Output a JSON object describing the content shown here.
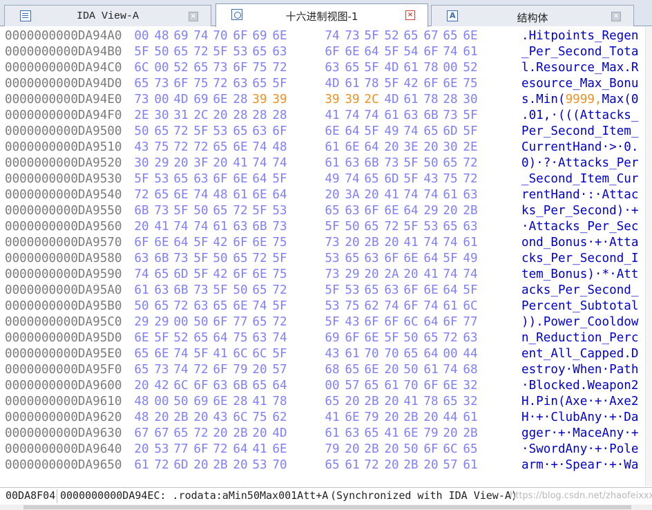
{
  "tabs": [
    {
      "label": "IDA View-A",
      "icon": "listing-icon",
      "active": false
    },
    {
      "label": "十六进制视图-1",
      "icon": "hex-view-icon",
      "active": true
    },
    {
      "label": "结构体",
      "icon": "structures-icon",
      "active": false
    }
  ],
  "close_glyph": "×",
  "hex_view": {
    "colors": {
      "address": "#7b7b7b",
      "bytes": "#8080ff",
      "highlight": "#f09020",
      "ascii": "#0000cc"
    },
    "rows": [
      {
        "address": "0000000000DA94A0",
        "bytes": [
          "00",
          "48",
          "69",
          "74",
          "70",
          "6F",
          "69",
          "6E",
          "74",
          "73",
          "5F",
          "52",
          "65",
          "67",
          "65",
          "6E"
        ],
        "ascii": ".Hitpoints_Regen"
      },
      {
        "address": "0000000000DA94B0",
        "bytes": [
          "5F",
          "50",
          "65",
          "72",
          "5F",
          "53",
          "65",
          "63",
          "6F",
          "6E",
          "64",
          "5F",
          "54",
          "6F",
          "74",
          "61"
        ],
        "ascii": "_Per_Second_Tota"
      },
      {
        "address": "0000000000DA94C0",
        "bytes": [
          "6C",
          "00",
          "52",
          "65",
          "73",
          "6F",
          "75",
          "72",
          "63",
          "65",
          "5F",
          "4D",
          "61",
          "78",
          "00",
          "52"
        ],
        "ascii": "l.Resource_Max.R"
      },
      {
        "address": "0000000000DA94D0",
        "bytes": [
          "65",
          "73",
          "6F",
          "75",
          "72",
          "63",
          "65",
          "5F",
          "4D",
          "61",
          "78",
          "5F",
          "42",
          "6F",
          "6E",
          "75"
        ],
        "ascii": "esource_Max_Bonu"
      },
      {
        "address": "0000000000DA94E0",
        "bytes": [
          "73",
          "00",
          "4D",
          "69",
          "6E",
          "28",
          "39",
          "39",
          "39",
          "39",
          "2C",
          "4D",
          "61",
          "78",
          "28",
          "30"
        ],
        "ascii": "s.Min(9999,Max(0",
        "highlight": [
          6,
          7,
          8,
          9,
          10
        ],
        "ascii_highlight": [
          6,
          11
        ]
      },
      {
        "address": "0000000000DA94F0",
        "bytes": [
          "2E",
          "30",
          "31",
          "2C",
          "20",
          "28",
          "28",
          "28",
          "41",
          "74",
          "74",
          "61",
          "63",
          "6B",
          "73",
          "5F"
        ],
        "ascii": ".01,·(((Attacks_"
      },
      {
        "address": "0000000000DA9500",
        "bytes": [
          "50",
          "65",
          "72",
          "5F",
          "53",
          "65",
          "63",
          "6F",
          "6E",
          "64",
          "5F",
          "49",
          "74",
          "65",
          "6D",
          "5F"
        ],
        "ascii": "Per_Second_Item_"
      },
      {
        "address": "0000000000DA9510",
        "bytes": [
          "43",
          "75",
          "72",
          "72",
          "65",
          "6E",
          "74",
          "48",
          "61",
          "6E",
          "64",
          "20",
          "3E",
          "20",
          "30",
          "2E"
        ],
        "ascii": "CurrentHand·>·0."
      },
      {
        "address": "0000000000DA9520",
        "bytes": [
          "30",
          "29",
          "20",
          "3F",
          "20",
          "41",
          "74",
          "74",
          "61",
          "63",
          "6B",
          "73",
          "5F",
          "50",
          "65",
          "72"
        ],
        "ascii": "0)·?·Attacks_Per"
      },
      {
        "address": "0000000000DA9530",
        "bytes": [
          "5F",
          "53",
          "65",
          "63",
          "6F",
          "6E",
          "64",
          "5F",
          "49",
          "74",
          "65",
          "6D",
          "5F",
          "43",
          "75",
          "72"
        ],
        "ascii": "_Second_Item_Cur"
      },
      {
        "address": "0000000000DA9540",
        "bytes": [
          "72",
          "65",
          "6E",
          "74",
          "48",
          "61",
          "6E",
          "64",
          "20",
          "3A",
          "20",
          "41",
          "74",
          "74",
          "61",
          "63"
        ],
        "ascii": "rentHand·:·Attac"
      },
      {
        "address": "0000000000DA9550",
        "bytes": [
          "6B",
          "73",
          "5F",
          "50",
          "65",
          "72",
          "5F",
          "53",
          "65",
          "63",
          "6F",
          "6E",
          "64",
          "29",
          "20",
          "2B"
        ],
        "ascii": "ks_Per_Second)·+"
      },
      {
        "address": "0000000000DA9560",
        "bytes": [
          "20",
          "41",
          "74",
          "74",
          "61",
          "63",
          "6B",
          "73",
          "5F",
          "50",
          "65",
          "72",
          "5F",
          "53",
          "65",
          "63"
        ],
        "ascii": "·Attacks_Per_Sec"
      },
      {
        "address": "0000000000DA9570",
        "bytes": [
          "6F",
          "6E",
          "64",
          "5F",
          "42",
          "6F",
          "6E",
          "75",
          "73",
          "20",
          "2B",
          "20",
          "41",
          "74",
          "74",
          "61"
        ],
        "ascii": "ond_Bonus·+·Atta"
      },
      {
        "address": "0000000000DA9580",
        "bytes": [
          "63",
          "6B",
          "73",
          "5F",
          "50",
          "65",
          "72",
          "5F",
          "53",
          "65",
          "63",
          "6F",
          "6E",
          "64",
          "5F",
          "49"
        ],
        "ascii": "cks_Per_Second_I"
      },
      {
        "address": "0000000000DA9590",
        "bytes": [
          "74",
          "65",
          "6D",
          "5F",
          "42",
          "6F",
          "6E",
          "75",
          "73",
          "29",
          "20",
          "2A",
          "20",
          "41",
          "74",
          "74"
        ],
        "ascii": "tem_Bonus)·*·Att"
      },
      {
        "address": "0000000000DA95A0",
        "bytes": [
          "61",
          "63",
          "6B",
          "73",
          "5F",
          "50",
          "65",
          "72",
          "5F",
          "53",
          "65",
          "63",
          "6F",
          "6E",
          "64",
          "5F"
        ],
        "ascii": "acks_Per_Second_"
      },
      {
        "address": "0000000000DA95B0",
        "bytes": [
          "50",
          "65",
          "72",
          "63",
          "65",
          "6E",
          "74",
          "5F",
          "53",
          "75",
          "62",
          "74",
          "6F",
          "74",
          "61",
          "6C"
        ],
        "ascii": "Percent_Subtotal"
      },
      {
        "address": "0000000000DA95C0",
        "bytes": [
          "29",
          "29",
          "00",
          "50",
          "6F",
          "77",
          "65",
          "72",
          "5F",
          "43",
          "6F",
          "6F",
          "6C",
          "64",
          "6F",
          "77"
        ],
        "ascii": ")).Power_Cooldow"
      },
      {
        "address": "0000000000DA95D0",
        "bytes": [
          "6E",
          "5F",
          "52",
          "65",
          "64",
          "75",
          "63",
          "74",
          "69",
          "6F",
          "6E",
          "5F",
          "50",
          "65",
          "72",
          "63"
        ],
        "ascii": "n_Reduction_Perc"
      },
      {
        "address": "0000000000DA95E0",
        "bytes": [
          "65",
          "6E",
          "74",
          "5F",
          "41",
          "6C",
          "6C",
          "5F",
          "43",
          "61",
          "70",
          "70",
          "65",
          "64",
          "00",
          "44"
        ],
        "ascii": "ent_All_Capped.D"
      },
      {
        "address": "0000000000DA95F0",
        "bytes": [
          "65",
          "73",
          "74",
          "72",
          "6F",
          "79",
          "20",
          "57",
          "68",
          "65",
          "6E",
          "20",
          "50",
          "61",
          "74",
          "68"
        ],
        "ascii": "estroy·When·Path"
      },
      {
        "address": "0000000000DA9600",
        "bytes": [
          "20",
          "42",
          "6C",
          "6F",
          "63",
          "6B",
          "65",
          "64",
          "00",
          "57",
          "65",
          "61",
          "70",
          "6F",
          "6E",
          "32"
        ],
        "ascii": "·Blocked.Weapon2"
      },
      {
        "address": "0000000000DA9610",
        "bytes": [
          "48",
          "00",
          "50",
          "69",
          "6E",
          "28",
          "41",
          "78",
          "65",
          "20",
          "2B",
          "20",
          "41",
          "78",
          "65",
          "32"
        ],
        "ascii": "H.Pin(Axe·+·Axe2"
      },
      {
        "address": "0000000000DA9620",
        "bytes": [
          "48",
          "20",
          "2B",
          "20",
          "43",
          "6C",
          "75",
          "62",
          "41",
          "6E",
          "79",
          "20",
          "2B",
          "20",
          "44",
          "61"
        ],
        "ascii": "H·+·ClubAny·+·Da"
      },
      {
        "address": "0000000000DA9630",
        "bytes": [
          "67",
          "67",
          "65",
          "72",
          "20",
          "2B",
          "20",
          "4D",
          "61",
          "63",
          "65",
          "41",
          "6E",
          "79",
          "20",
          "2B"
        ],
        "ascii": "gger·+·MaceAny·+"
      },
      {
        "address": "0000000000DA9640",
        "bytes": [
          "20",
          "53",
          "77",
          "6F",
          "72",
          "64",
          "41",
          "6E",
          "79",
          "20",
          "2B",
          "20",
          "50",
          "6F",
          "6C",
          "65"
        ],
        "ascii": "·SwordAny·+·Pole"
      },
      {
        "address": "0000000000DA9650",
        "bytes": [
          "61",
          "72",
          "6D",
          "20",
          "2B",
          "20",
          "53",
          "70",
          "65",
          "61",
          "72",
          "20",
          "2B",
          "20",
          "57",
          "61"
        ],
        "ascii": "arm·+·Spear·+·Wa"
      }
    ]
  },
  "status": {
    "offset": "00DA8F04",
    "location": "0000000000DA94EC: .rodata:aMin50Max001Att+A",
    "sync": "(Synchronized with IDA View-A)",
    "watermark": "https://blog.csdn.net/zhaofeixxx"
  }
}
